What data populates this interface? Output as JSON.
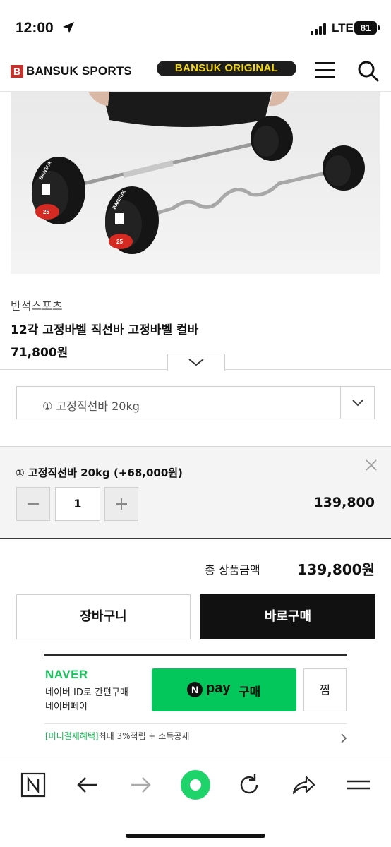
{
  "status_bar": {
    "time": "12:00",
    "network": "LTE",
    "battery": "81"
  },
  "header": {
    "logo_mark": "B",
    "logo_text": "BANSUK SPORTS",
    "badge": "BANSUK ORIGINAL",
    "icons": [
      "menu-icon",
      "search-icon"
    ]
  },
  "product": {
    "image_text": {
      "brand_on_plate": "BANSUK",
      "plate_weight": "25"
    },
    "brand": "반석스포츠",
    "title": "12각 고정바벨 직선바 고정바벨 컬바",
    "price": "71,800원"
  },
  "option_select": {
    "value": "① 고정직선바 20kg"
  },
  "selected_option": {
    "name": "① 고정직선바 20kg (+68,000원)",
    "quantity": "1",
    "price": "139,800"
  },
  "total": {
    "label": "총 상품금액",
    "value": "139,800원"
  },
  "buttons": {
    "cart": "장바구니",
    "buy_now": "바로구매"
  },
  "naver": {
    "brand": "NAVER",
    "line1": "네이버 ID로 간편구매",
    "line2": "네이버페이",
    "pay_logo": "N",
    "pay_text": "pay",
    "pay_buy": "구매",
    "zzim": "찜",
    "benefit_tag": "[머니결제혜택]",
    "benefit_text": "최대 3%적립 + 소득공제"
  },
  "toolbar": {
    "icons": [
      "naver-n-icon",
      "back-arrow-icon",
      "forward-arrow-icon",
      "home-dot-icon",
      "refresh-icon",
      "share-icon",
      "menu-lines-icon"
    ]
  },
  "colors": {
    "brand_red": "#c4322b",
    "badge_yellow": "#f5d80a",
    "naver_green": "#03c75a",
    "toolbar_green": "#1dd36a"
  }
}
